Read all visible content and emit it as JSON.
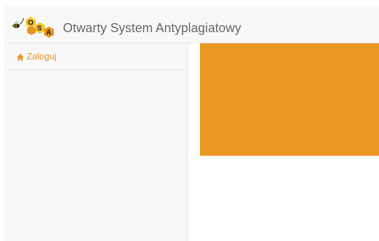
{
  "header": {
    "logo_letters": [
      "O",
      "S",
      "A"
    ],
    "title": "Otwarty System Antyplagiatowy"
  },
  "sidebar": {
    "items": [
      {
        "label": "Zaloguj",
        "icon": "home-icon"
      }
    ]
  },
  "colors": {
    "accent": "#e8941f",
    "banner": "#eb9822",
    "navbar_bg": "#f8f8f8",
    "border": "#e7e7e7"
  }
}
